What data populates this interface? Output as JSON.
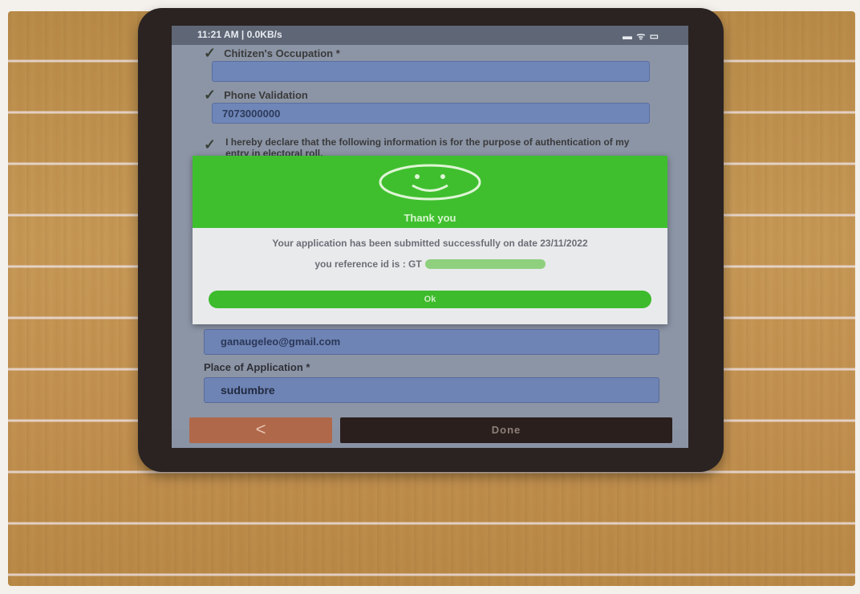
{
  "status_bar": {
    "time": "11:21 AM | 0.0KB/s",
    "icons": "▬ ᯤ ▭"
  },
  "form": {
    "row1_label": "Chitizen's Occupation *",
    "row2_label": "Phone Validation",
    "row2_value": "7073000000",
    "consent_text": "I hereby declare that the following information is for the purpose of authentication of my entry in electoral roll."
  },
  "dialog": {
    "title": "Thank you",
    "message": "Your application has been submitted successfully on date 23/11/2022",
    "reference_prefix": "you reference id is : GT",
    "ok_label": "Ok"
  },
  "email": {
    "value": "ganaugeleo@gmail.com"
  },
  "place": {
    "label": "Place of Application *",
    "value": "sudumbre"
  },
  "buttons": {
    "back_label": "<",
    "done_label": "Done"
  },
  "colors": {
    "dialog_header": "#3fbf2e",
    "ok_button": "#3dbb2c",
    "back_button": "#b0684a",
    "done_button": "#2a1f1c"
  }
}
